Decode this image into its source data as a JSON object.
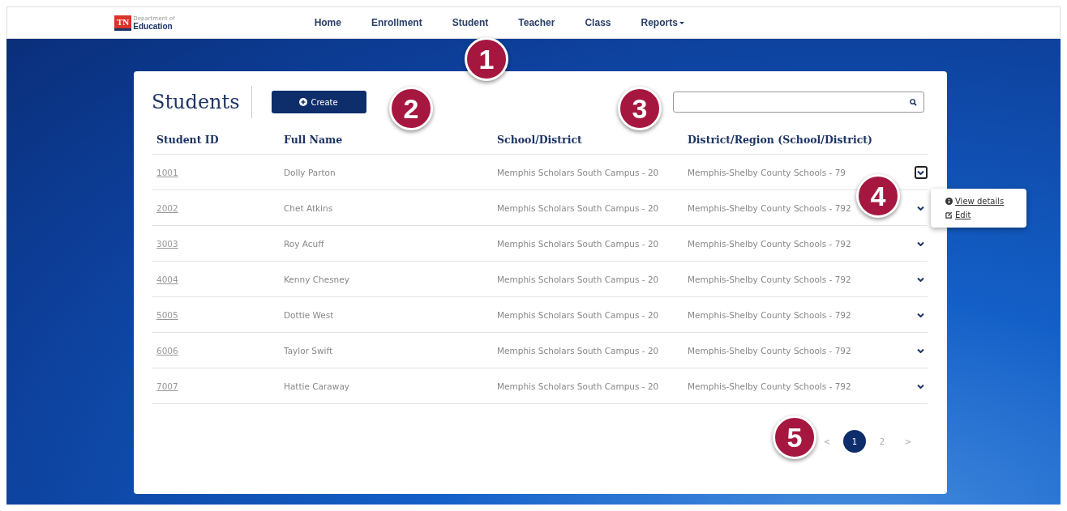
{
  "logo": {
    "mark": "TN",
    "small": "Department of",
    "name": "Education"
  },
  "nav": [
    {
      "label": "Home",
      "dropdown": false
    },
    {
      "label": "Enrollment",
      "dropdown": false
    },
    {
      "label": "Student",
      "dropdown": false
    },
    {
      "label": "Teacher",
      "dropdown": false
    },
    {
      "label": "Class",
      "dropdown": false
    },
    {
      "label": "Reports",
      "dropdown": true
    }
  ],
  "page_title": "Students",
  "create_button": "Create",
  "table": {
    "columns": [
      "Student ID",
      "Full Name",
      "School/District",
      "District/Region (School/District)"
    ],
    "rows": [
      {
        "id": "1001",
        "name": "Dolly Parton",
        "school": "Memphis Scholars South Campus - 20",
        "district": "Memphis-Shelby County Schools - 79",
        "expanded": true
      },
      {
        "id": "2002",
        "name": "Chet Atkins",
        "school": "Memphis Scholars South Campus - 20",
        "district": "Memphis-Shelby County Schools - 792",
        "expanded": false
      },
      {
        "id": "3003",
        "name": "Roy Acuff",
        "school": "Memphis Scholars South Campus - 20",
        "district": "Memphis-Shelby County Schools - 792",
        "expanded": false
      },
      {
        "id": "4004",
        "name": "Kenny Chesney",
        "school": "Memphis Scholars South Campus - 20",
        "district": "Memphis-Shelby County Schools - 792",
        "expanded": false
      },
      {
        "id": "5005",
        "name": "Dottie West",
        "school": "Memphis Scholars South Campus - 20",
        "district": "Memphis-Shelby County Schools - 792",
        "expanded": false
      },
      {
        "id": "6006",
        "name": "Taylor Swift",
        "school": "Memphis Scholars South Campus - 20",
        "district": "Memphis-Shelby County Schools - 792",
        "expanded": false
      },
      {
        "id": "7007",
        "name": "Hattie Caraway",
        "school": "Memphis Scholars South Campus - 20",
        "district": "Memphis-Shelby County Schools - 792",
        "expanded": false
      }
    ]
  },
  "row_menu": [
    {
      "kind": "details",
      "label": "View details"
    },
    {
      "kind": "edit",
      "label": "Edit"
    }
  ],
  "pagination": {
    "prev": "<",
    "pages": [
      {
        "label": "1",
        "selected": true
      },
      {
        "label": "2",
        "selected": false
      }
    ],
    "next": ">"
  },
  "callouts": [
    "1",
    "2",
    "3",
    "4",
    "5"
  ]
}
